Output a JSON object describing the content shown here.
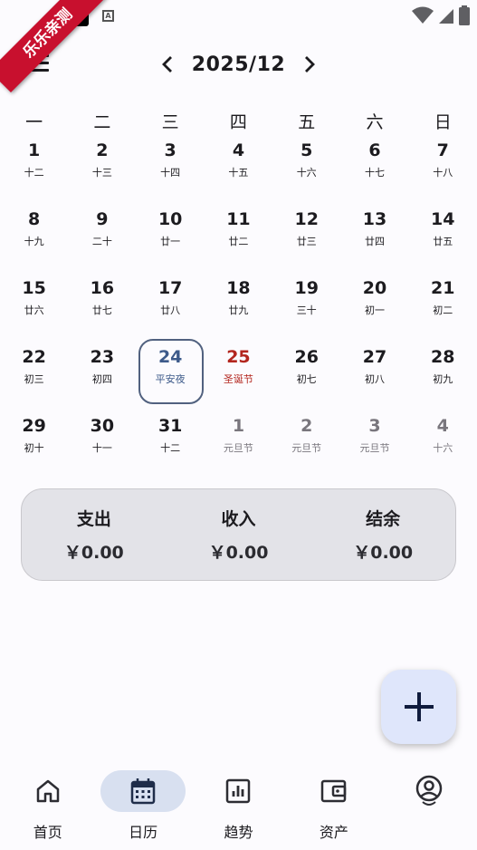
{
  "ribbon": {
    "text": "乐乐亲测"
  },
  "header": {
    "month_title": "2025/12"
  },
  "weekdays": [
    "一",
    "二",
    "三",
    "四",
    "五",
    "六",
    "日"
  ],
  "weeks": [
    [
      {
        "num": "1",
        "lunar": "十二"
      },
      {
        "num": "2",
        "lunar": "十三"
      },
      {
        "num": "3",
        "lunar": "十四"
      },
      {
        "num": "4",
        "lunar": "十五"
      },
      {
        "num": "5",
        "lunar": "十六"
      },
      {
        "num": "6",
        "lunar": "十七"
      },
      {
        "num": "7",
        "lunar": "十八"
      }
    ],
    [
      {
        "num": "8",
        "lunar": "十九"
      },
      {
        "num": "9",
        "lunar": "二十"
      },
      {
        "num": "10",
        "lunar": "廿一"
      },
      {
        "num": "11",
        "lunar": "廿二"
      },
      {
        "num": "12",
        "lunar": "廿三"
      },
      {
        "num": "13",
        "lunar": "廿四"
      },
      {
        "num": "14",
        "lunar": "廿五"
      }
    ],
    [
      {
        "num": "15",
        "lunar": "廿六"
      },
      {
        "num": "16",
        "lunar": "廿七"
      },
      {
        "num": "17",
        "lunar": "廿八"
      },
      {
        "num": "18",
        "lunar": "廿九"
      },
      {
        "num": "19",
        "lunar": "三十"
      },
      {
        "num": "20",
        "lunar": "初一"
      },
      {
        "num": "21",
        "lunar": "初二"
      }
    ],
    [
      {
        "num": "22",
        "lunar": "初三"
      },
      {
        "num": "23",
        "lunar": "初四"
      },
      {
        "num": "24",
        "lunar": "平安夜",
        "state": "today"
      },
      {
        "num": "25",
        "lunar": "圣诞节",
        "state": "holiday"
      },
      {
        "num": "26",
        "lunar": "初七"
      },
      {
        "num": "27",
        "lunar": "初八"
      },
      {
        "num": "28",
        "lunar": "初九"
      }
    ],
    [
      {
        "num": "29",
        "lunar": "初十"
      },
      {
        "num": "30",
        "lunar": "十一"
      },
      {
        "num": "31",
        "lunar": "十二"
      },
      {
        "num": "1",
        "lunar": "元旦节",
        "state": "other"
      },
      {
        "num": "2",
        "lunar": "元旦节",
        "state": "other"
      },
      {
        "num": "3",
        "lunar": "元旦节",
        "state": "other"
      },
      {
        "num": "4",
        "lunar": "十六",
        "state": "other"
      }
    ]
  ],
  "summary": {
    "expense_label": "支出",
    "expense_value": "￥0.00",
    "income_label": "收入",
    "income_value": "￥0.00",
    "balance_label": "结余",
    "balance_value": "￥0.00"
  },
  "nav": [
    {
      "label": "首页",
      "icon": "home-icon"
    },
    {
      "label": "日历",
      "icon": "calendar-icon",
      "active": true
    },
    {
      "label": "趋势",
      "icon": "chart-icon"
    },
    {
      "label": "资产",
      "icon": "wallet-icon"
    },
    {
      "label": "",
      "icon": "profile-icon"
    }
  ]
}
